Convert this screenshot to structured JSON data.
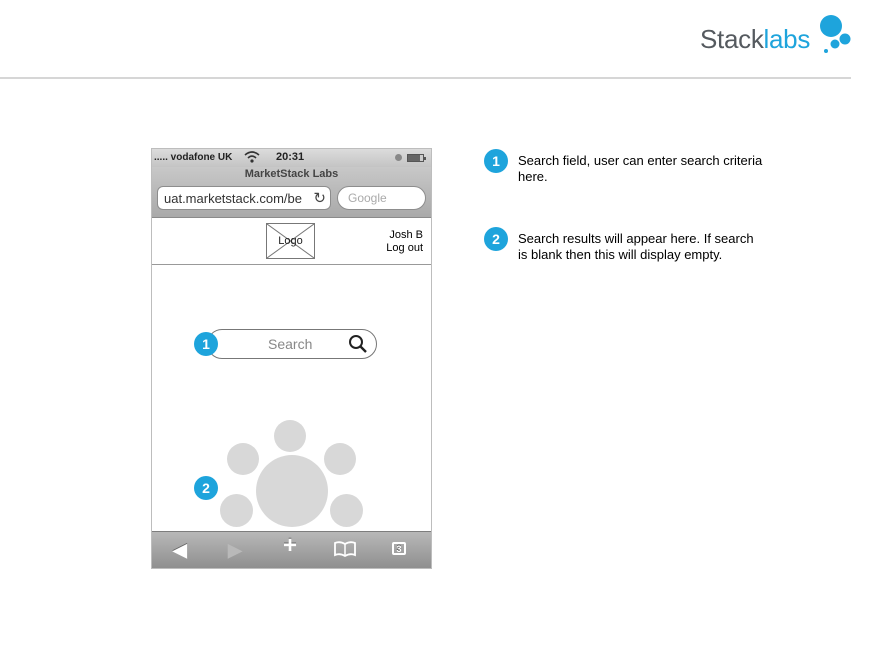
{
  "brand": {
    "part1": "Stack",
    "part2": "labs",
    "accent": "#1ea4dc"
  },
  "phone": {
    "status": {
      "carrier": "..... vodafone UK",
      "time": "20:31"
    },
    "page_title": "MarketStack Labs",
    "url": "uat.marketstack.com/be",
    "search_engine_placeholder": "Google",
    "header": {
      "logo_label": "Logo",
      "user_name": "Josh B",
      "logout_label": "Log out"
    },
    "search": {
      "placeholder": "Search"
    },
    "toolbar": {
      "tabs_count": "3"
    }
  },
  "callouts": [
    {
      "number": "1",
      "text": "Search field, user can enter search criteria here."
    },
    {
      "number": "2",
      "text": "Search results will appear here. If search is blank then this will display empty."
    }
  ],
  "icons": {
    "wifi": "wifi-icon",
    "reload": "reload-icon",
    "search": "magnifier-icon",
    "back": "back-arrow-icon",
    "forward": "forward-arrow-icon",
    "add": "plus-icon",
    "bookmarks": "book-icon",
    "tabs": "tabs-icon"
  }
}
